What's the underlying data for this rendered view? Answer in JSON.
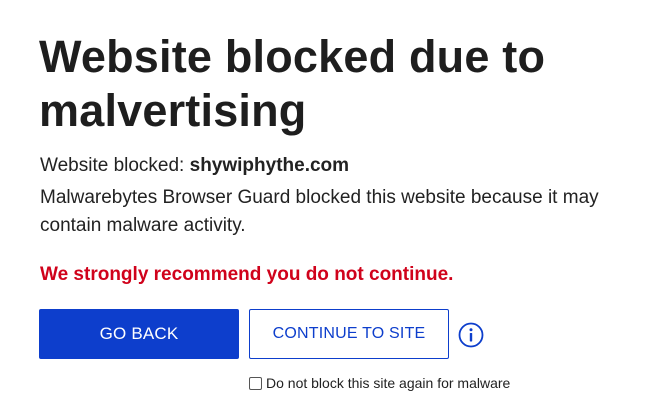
{
  "title": "Website blocked due to malvertising",
  "blocked": {
    "label": "Website blocked: ",
    "domain": "shywiphythe.com"
  },
  "description": "Malwarebytes Browser Guard blocked this website because it may contain malware activity.",
  "warning": "We strongly recommend you do not continue.",
  "buttons": {
    "go_back": "GO BACK",
    "continue": "CONTINUE TO SITE"
  },
  "info_icon": "info-icon",
  "checkbox": {
    "label": "Do not block this site again for malware",
    "checked": false
  },
  "colors": {
    "accent": "#0d3ecc",
    "warning": "#d0021b",
    "text": "#222222",
    "background": "#ffffff"
  }
}
